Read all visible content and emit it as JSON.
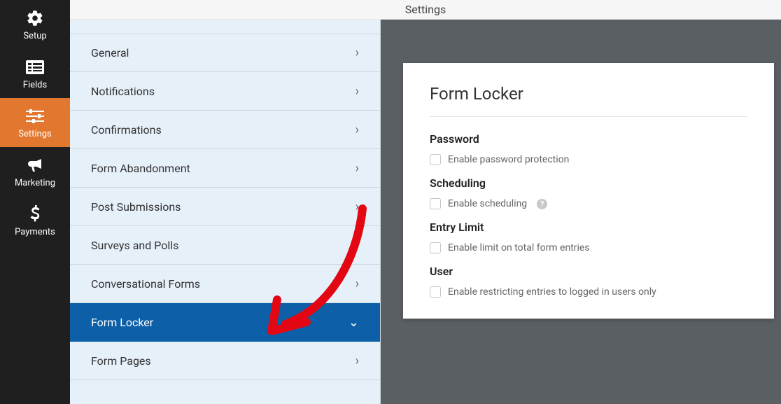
{
  "topbar": {
    "title": "Settings"
  },
  "sidebar": {
    "items": [
      {
        "label": "Setup"
      },
      {
        "label": "Fields"
      },
      {
        "label": "Settings"
      },
      {
        "label": "Marketing"
      },
      {
        "label": "Payments"
      }
    ]
  },
  "submenu": {
    "items": [
      {
        "label": "General"
      },
      {
        "label": "Notifications"
      },
      {
        "label": "Confirmations"
      },
      {
        "label": "Form Abandonment"
      },
      {
        "label": "Post Submissions"
      },
      {
        "label": "Surveys and Polls"
      },
      {
        "label": "Conversational Forms"
      },
      {
        "label": "Form Locker"
      },
      {
        "label": "Form Pages"
      }
    ]
  },
  "panel": {
    "title": "Form Locker",
    "password_label": "Password",
    "password_check": "Enable password protection",
    "scheduling_label": "Scheduling",
    "scheduling_check": "Enable scheduling",
    "entry_label": "Entry Limit",
    "entry_check": "Enable limit on total form entries",
    "user_label": "User",
    "user_check": "Enable restricting entries to logged in users only"
  }
}
